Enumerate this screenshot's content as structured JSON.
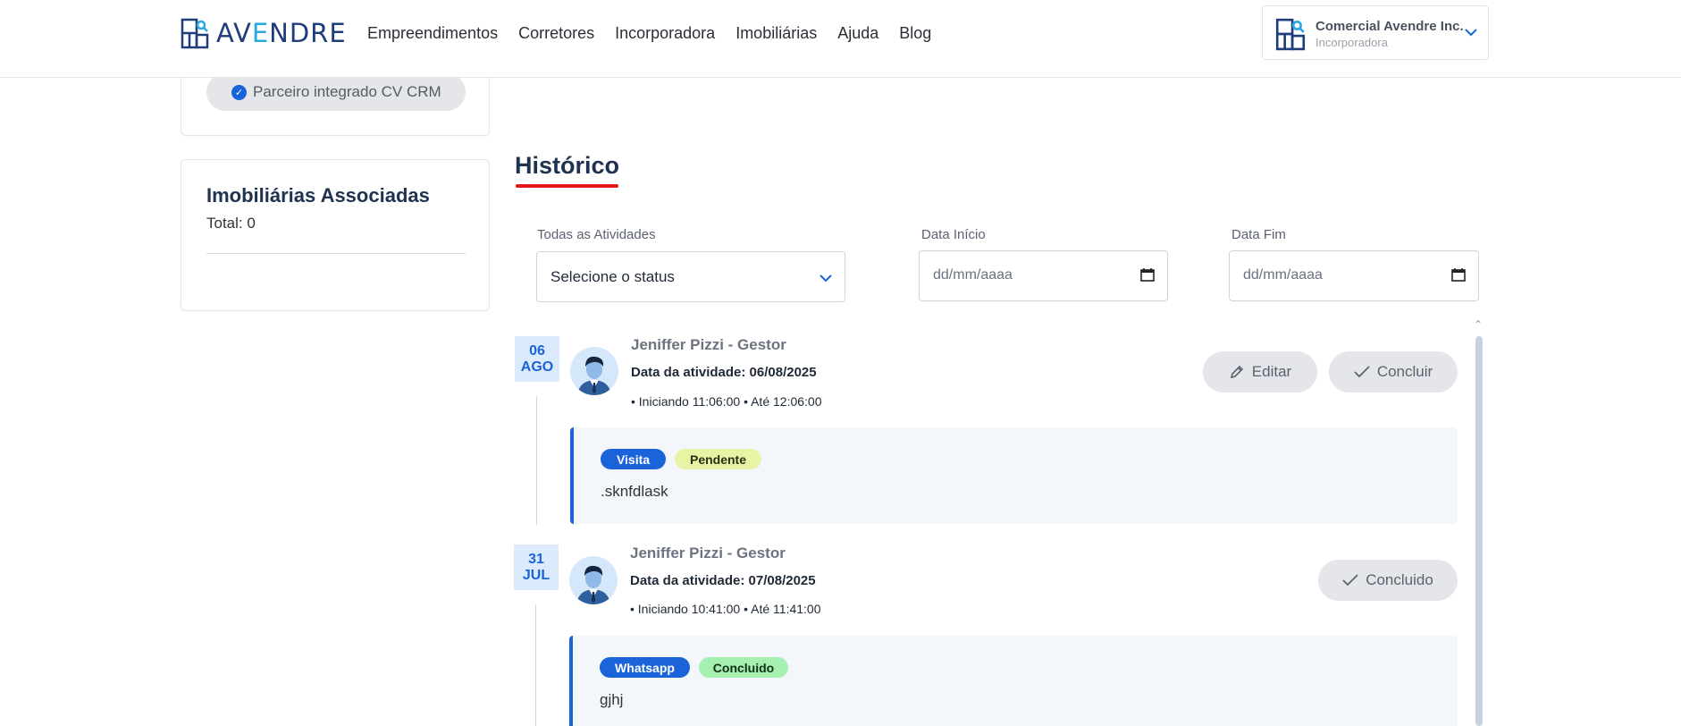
{
  "brand": {
    "name_pre": "AV",
    "name_accent": "E",
    "name_post": "NDRE"
  },
  "nav": [
    "Empreendimentos",
    "Corretores",
    "Incorporadora",
    "Imobiliárias",
    "Ajuda",
    "Blog"
  ],
  "account": {
    "company": "Comercial Avendre Inc.",
    "role": "Incorporadora"
  },
  "partner_badge": "Parceiro integrado CV CRM",
  "associated": {
    "title": "Imobiliárias Associadas",
    "total": "Total: 0"
  },
  "history": {
    "title": "Histórico",
    "filters": {
      "activities_label": "Todas as Atividades",
      "status_placeholder": "Selecione o status",
      "start_label": "Data Início",
      "start_value": "dd/mm/aaaa",
      "end_label": "Data Fim",
      "end_value": "dd/mm/aaaa"
    },
    "entries": [
      {
        "day": "06",
        "month": "AGO",
        "author": "Jeniffer Pizzi - Gestor",
        "date": "Data da atividade: 06/08/2025",
        "times": "• Iniciando 11:06:00 • Até 12:06:00",
        "edit_label": "Editar",
        "conclude_label": "Concluir",
        "type": "Visita",
        "status": "Pendente",
        "note": ".sknfdlask"
      },
      {
        "day": "31",
        "month": "JUL",
        "author": "Jeniffer Pizzi - Gestor",
        "date": "Data da atividade: 07/08/2025",
        "times": "• Iniciando 10:41:00 • Até 11:41:00",
        "done_label": "Concluido",
        "type": "Whatsapp",
        "status": "Concluido",
        "note": "gjhj"
      }
    ]
  },
  "colors": {
    "brand_blue": "#1f3d7a",
    "accent": "#1a63d8",
    "underline": "#e01818",
    "pending": "#e9f3a5",
    "done": "#a5efb1"
  }
}
